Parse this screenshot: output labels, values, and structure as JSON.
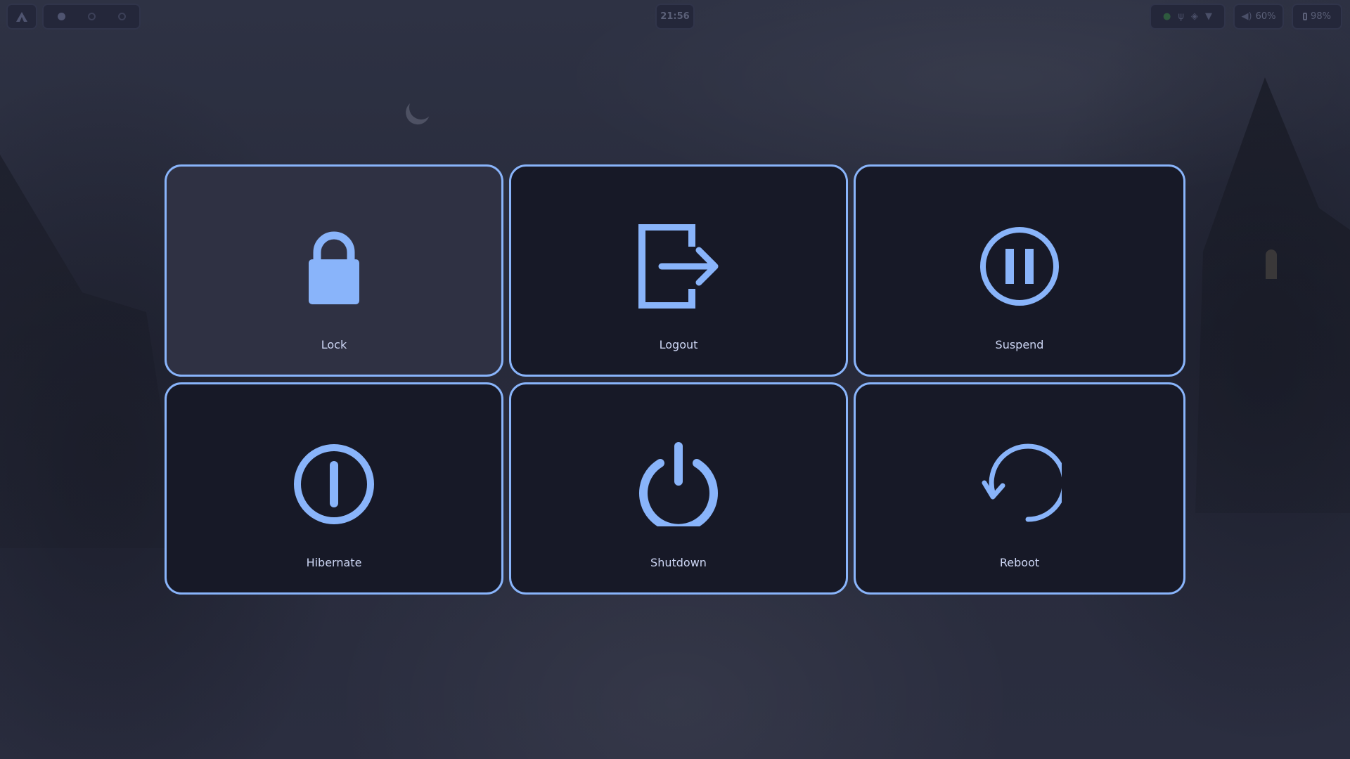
{
  "theme": {
    "accent": "#89b4fa",
    "button_bg": "#171927",
    "button_focused_bg": "#2f3143",
    "label_color": "#cdd6f4"
  },
  "top_bar": {
    "logo_icon": "arch-logo-icon",
    "workspaces": [
      {
        "name": "workspace-1",
        "active": true
      },
      {
        "name": "workspace-2",
        "active": false
      },
      {
        "name": "workspace-3",
        "active": false
      }
    ],
    "clock": "21:56",
    "tray_icons": [
      "spotify-icon",
      "usb-icon",
      "discord-icon",
      "wifi-icon"
    ],
    "volume": {
      "icon": "speaker-icon",
      "value": "60%"
    },
    "battery": {
      "icon": "battery-icon",
      "value": "98%"
    }
  },
  "power_menu": {
    "items": [
      {
        "label": "Lock",
        "icon": "lock-icon",
        "focused": true
      },
      {
        "label": "Logout",
        "icon": "logout-icon",
        "focused": false
      },
      {
        "label": "Suspend",
        "icon": "suspend-icon",
        "focused": false
      },
      {
        "label": "Hibernate",
        "icon": "hibernate-icon",
        "focused": false
      },
      {
        "label": "Shutdown",
        "icon": "power-icon",
        "focused": false
      },
      {
        "label": "Reboot",
        "icon": "reboot-icon",
        "focused": false
      }
    ]
  }
}
